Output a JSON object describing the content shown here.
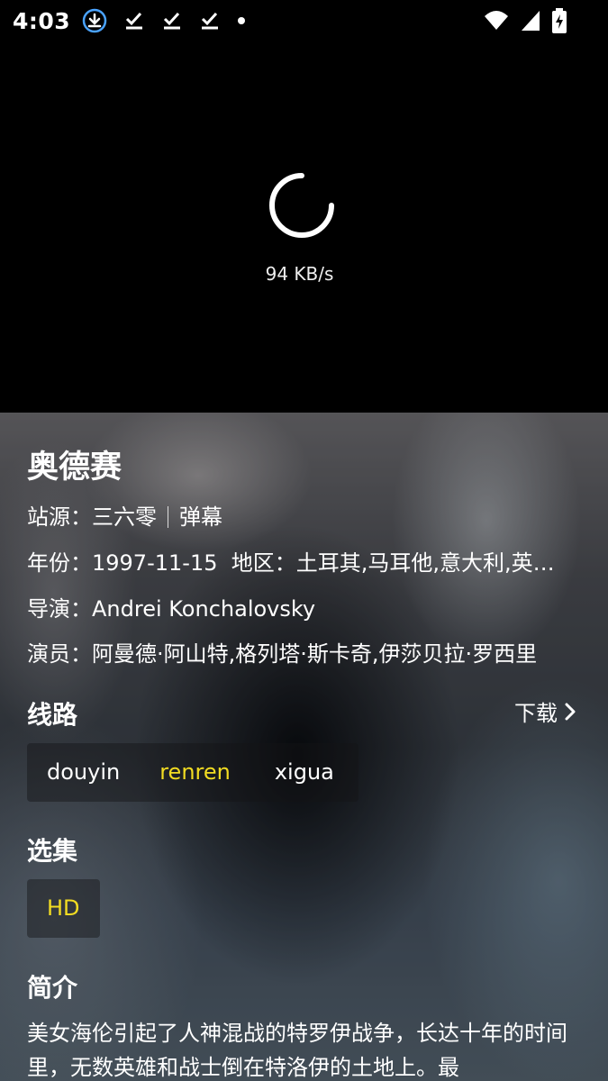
{
  "status_bar": {
    "time": "4:03",
    "notification_icons": [
      "download-icon",
      "download-done-icon",
      "download-done-icon",
      "download-done-icon",
      "dot-icon"
    ],
    "system_icons": [
      "wifi-icon",
      "signal-icon",
      "battery-charging-icon"
    ]
  },
  "player": {
    "speed": "94 KB/s"
  },
  "movie": {
    "title": "奥德赛",
    "source_label": "站源：",
    "source_value": "三六零",
    "danmaku_label": "弹幕",
    "year_label": "年份：",
    "year_value": "1997-11-15",
    "region_label": "地区：",
    "region_value": "土耳其,马耳他,意大利,英…",
    "director_label": "导演：",
    "director_value": "Andrei Konchalovsky",
    "cast_label": "演员：",
    "cast_value": "阿曼德·阿山特,格列塔·斯卡奇,伊莎贝拉·罗西里"
  },
  "routes": {
    "title": "线路",
    "download_label": "下载",
    "items": [
      "douyin",
      "renren",
      "xigua"
    ],
    "active_index": 1
  },
  "episodes": {
    "title": "选集",
    "items": [
      "HD"
    ]
  },
  "synopsis": {
    "title": "简介",
    "text": "美女海伦引起了人神混战的特罗伊战争，长达十年的时间里，无数英雄和战士倒在特洛伊的土地上。最"
  },
  "colors": {
    "accent": "#f2dc22",
    "background": "#000000"
  }
}
